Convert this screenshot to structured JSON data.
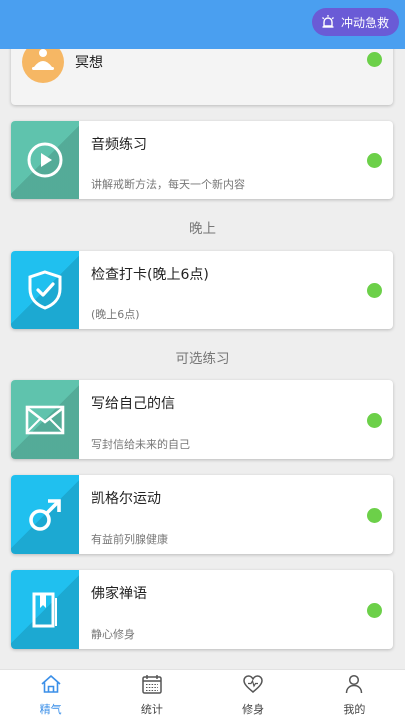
{
  "header": {
    "sos_label": "冲动急救"
  },
  "cards": [
    {
      "title": "冥想",
      "subtitle": "",
      "icon": "meditation-icon",
      "status": "on"
    },
    {
      "title": "音频练习",
      "subtitle": "讲解戒断方法，每天一个新内容",
      "icon": "play-icon",
      "color": "#5fc3ad",
      "status": "on"
    },
    {
      "title": "检查打卡(晚上6点)",
      "subtitle": "(晚上6点)",
      "icon": "shield-check-icon",
      "color": "#20c0ef",
      "status": "on"
    },
    {
      "title": "写给自己的信",
      "subtitle": "写封信给未来的自己",
      "icon": "envelope-icon",
      "color": "#5fc3ad",
      "status": "on"
    },
    {
      "title": "凯格尔运动",
      "subtitle": "有益前列腺健康",
      "icon": "male-symbol-icon",
      "color": "#20c0ef",
      "status": "on"
    },
    {
      "title": "佛家禅语",
      "subtitle": "静心修身",
      "icon": "book-icon",
      "color": "#20c0ef",
      "status": "on"
    }
  ],
  "sections": {
    "evening": "晚上",
    "optional": "可选练习"
  },
  "colors": {
    "accent": "#4a9ff0",
    "sos": "#6a5bd6",
    "status_on": "#6cd049"
  },
  "nav": [
    {
      "label": "精气",
      "icon": "home-icon",
      "active": true
    },
    {
      "label": "统计",
      "icon": "calendar-icon",
      "active": false
    },
    {
      "label": "修身",
      "icon": "heart-icon",
      "active": false
    },
    {
      "label": "我的",
      "icon": "user-icon",
      "active": false
    }
  ]
}
